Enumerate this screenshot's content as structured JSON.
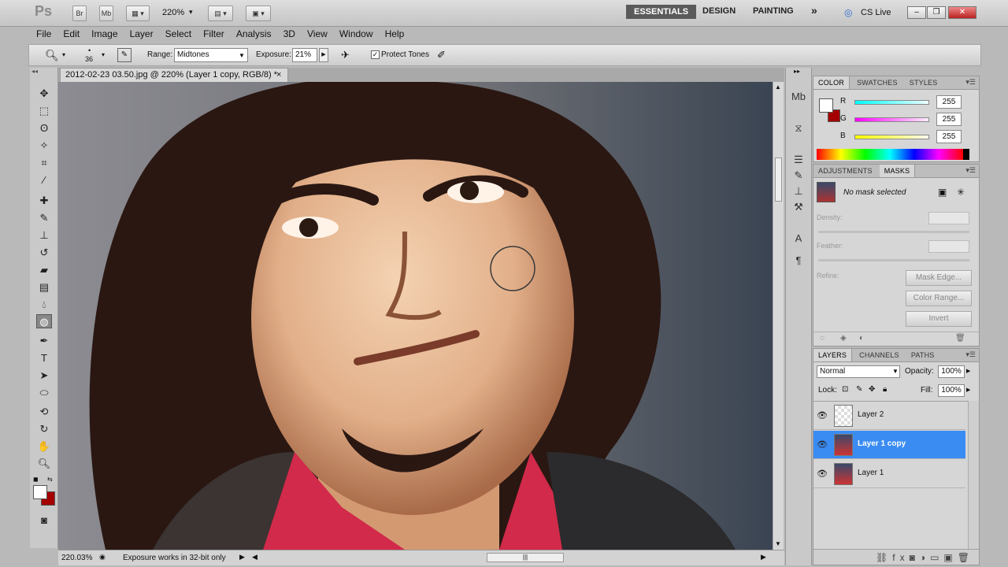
{
  "app": {
    "logo": "Ps",
    "bridge_label": "Br",
    "minibridge_label": "Mb",
    "zoom_label": "220%",
    "workspaces": [
      "ESSENTIALS",
      "DESIGN",
      "PAINTING"
    ],
    "more_label": "»",
    "cslive_label": "CS Live"
  },
  "menu": [
    "File",
    "Edit",
    "Image",
    "Layer",
    "Select",
    "Filter",
    "Analysis",
    "3D",
    "View",
    "Window",
    "Help"
  ],
  "options": {
    "brush_size": "36",
    "range_label": "Range:",
    "range_value": "Midtones",
    "exposure_label": "Exposure:",
    "exposure_value": "21%",
    "protect_tones_label": "Protect Tones"
  },
  "document": {
    "tab_title": "2012-02-23 03.50.jpg @ 220% (Layer 1 copy, RGB/8) *",
    "close_label": "×"
  },
  "status": {
    "zoom": "220.03%",
    "message": "Exposure works in 32-bit only"
  },
  "color_panel": {
    "tabs": [
      "COLOR",
      "SWATCHES",
      "STYLES"
    ],
    "channels": [
      {
        "label": "R",
        "value": "255",
        "color": "#39d3e0"
      },
      {
        "label": "G",
        "value": "255",
        "color": "#e23de0"
      },
      {
        "label": "B",
        "value": "255",
        "color": "#e6e33a"
      }
    ],
    "foreground": "#ffffff",
    "background": "#a50000"
  },
  "masks_panel": {
    "tabs": [
      "ADJUSTMENTS",
      "MASKS"
    ],
    "status": "No mask selected",
    "density_label": "Density:",
    "feather_label": "Feather:",
    "refine_label": "Refine:",
    "buttons": [
      "Mask Edge...",
      "Color Range...",
      "Invert"
    ]
  },
  "layers_panel": {
    "tabs": [
      "LAYERS",
      "CHANNELS",
      "PATHS"
    ],
    "blend_mode": "Normal",
    "opacity_label": "Opacity:",
    "opacity_value": "100%",
    "lock_label": "Lock:",
    "fill_label": "Fill:",
    "fill_value": "100%",
    "layers": [
      {
        "name": "Layer 2",
        "selected": false
      },
      {
        "name": "Layer 1 copy",
        "selected": true
      },
      {
        "name": "Layer 1",
        "selected": false
      }
    ]
  }
}
